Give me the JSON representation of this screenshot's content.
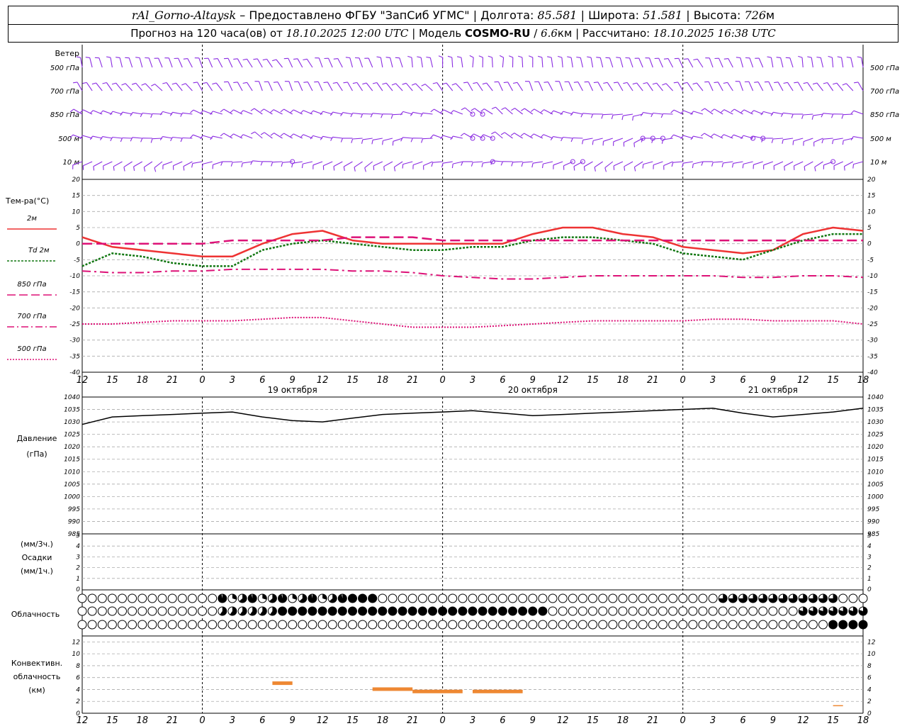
{
  "header": {
    "station": "rAl_Gorno-Altaysk",
    "provider": "Предоставлено ФГБУ \"ЗапСиб УГМС\"",
    "lon_label": "Долгота:",
    "lon": "85.581",
    "lat_label": "Широта:",
    "lat": "51.581",
    "alt_label": "Высота:",
    "alt": "726",
    "alt_unit": "м",
    "forecast_label": "Прогноз на 120 часа(ов)",
    "from_label": "от",
    "issued": "18.10.2025 12:00 UTC",
    "model_label": "Модель",
    "model": "COSMO-RU",
    "resolution_value": "6.6",
    "resolution_unit": "км",
    "computed_label": "Рассчитано:",
    "computed": "18.10.2025 16:38 UTC"
  },
  "wind_panel": {
    "title": "Ветер",
    "levels": [
      "500 гПа",
      "700 гПа",
      "850 гПа",
      "500 м",
      "10  м"
    ]
  },
  "temp_panel": {
    "title": "Тем-ра(°С)",
    "legend": [
      {
        "label": "2м",
        "color": "#ee3333",
        "style": "solid"
      },
      {
        "label": "Td  2м",
        "color": "#117711",
        "style": "dotted"
      },
      {
        "label": "850 гПа",
        "color": "#dd1177",
        "style": "long-dash"
      },
      {
        "label": "700 гПа",
        "color": "#dd1177",
        "style": "dash-dot"
      },
      {
        "label": "500 гПа",
        "color": "#dd1177",
        "style": "dotted"
      }
    ]
  },
  "pressure_panel": {
    "title": "Давление",
    "unit": "(гПа)"
  },
  "precip_panel": {
    "unit1": "(мм/3ч.)",
    "title": "Осадки",
    "unit2": "(мм/1ч.)"
  },
  "cloud_panel": {
    "title": "Облачность"
  },
  "conv_panel": {
    "title1": "Конвективн.",
    "title2": "облачность",
    "unit": "(км)"
  },
  "time_axis": {
    "hour_labels": [
      "12",
      "15",
      "18",
      "21",
      "0",
      "3",
      "6",
      "9",
      "12",
      "15",
      "18",
      "21",
      "0",
      "3",
      "6",
      "9",
      "12",
      "15",
      "18",
      "21",
      "0",
      "3",
      "6",
      "9",
      "12",
      "15",
      "18"
    ],
    "day_labels": [
      {
        "label": "19 октября",
        "hour_index": 7
      },
      {
        "label": "20 октября",
        "hour_index": 15
      },
      {
        "label": "21 октября",
        "hour_index": 23
      }
    ]
  },
  "colors": {
    "wind": "#8a2be2",
    "grid": "#aaaaaa",
    "t2m": "#ee3333",
    "td2m": "#117711",
    "upper": "#dd1177",
    "pressure": "#000000",
    "convective": "#ee8833"
  },
  "chart_data": [
    {
      "type": "line",
      "title": "Тем-ра(°С)",
      "ylim": [
        -40,
        20
      ],
      "yticks": [
        20,
        15,
        10,
        5,
        0,
        -5,
        -10,
        -15,
        -20,
        -25,
        -30,
        -35,
        -40
      ],
      "x_hours": [
        0,
        3,
        6,
        9,
        12,
        15,
        18,
        21,
        24,
        27,
        30,
        33,
        36,
        39,
        42,
        45,
        48,
        51,
        54,
        57,
        60,
        63,
        66,
        69,
        72,
        75,
        78
      ],
      "series": [
        {
          "name": "2м",
          "values": [
            2,
            -1,
            -2,
            -3,
            -4,
            -4,
            0,
            3,
            4,
            1,
            0,
            0,
            0,
            0,
            0,
            3,
            5,
            5,
            3,
            2,
            -1,
            -2,
            -3,
            -2,
            3,
            5,
            4
          ]
        },
        {
          "name": "Td 2м",
          "values": [
            -7,
            -3,
            -4,
            -6,
            -7,
            -7,
            -2,
            0,
            1,
            0,
            -1,
            -2,
            -2,
            -1,
            -1,
            1,
            2,
            2,
            1,
            0,
            -3,
            -4,
            -5,
            -2,
            1,
            3,
            3
          ]
        },
        {
          "name": "850 гПа",
          "values": [
            0,
            0,
            0,
            0,
            0,
            1,
            1,
            1,
            1,
            2,
            2,
            2,
            1,
            1,
            1,
            1,
            1,
            1,
            1,
            1,
            1,
            1,
            1,
            1,
            1,
            1,
            1
          ]
        },
        {
          "name": "700 гПа",
          "values": [
            -8.5,
            -9,
            -9,
            -8.5,
            -8.5,
            -8,
            -8,
            -8,
            -8,
            -8.5,
            -8.5,
            -9,
            -10,
            -10.5,
            -11,
            -11,
            -10.5,
            -10,
            -10,
            -10,
            -10,
            -10,
            -10.5,
            -10.5,
            -10,
            -10,
            -10.5
          ]
        },
        {
          "name": "500 гПа",
          "values": [
            -25,
            -25,
            -24.5,
            -24,
            -24,
            -24,
            -23.5,
            -23,
            -23,
            -24,
            -25,
            -26,
            -26,
            -26,
            -25.5,
            -25,
            -24.5,
            -24,
            -24,
            -24,
            -24,
            -23.5,
            -23.5,
            -24,
            -24,
            -24,
            -25
          ]
        }
      ]
    },
    {
      "type": "line",
      "title": "Давление",
      "ylim": [
        985,
        1040
      ],
      "yticks": [
        1040,
        1035,
        1030,
        1025,
        1020,
        1015,
        1010,
        1005,
        1000,
        995,
        990,
        985
      ],
      "x_hours": [
        0,
        3,
        6,
        9,
        12,
        15,
        18,
        21,
        24,
        27,
        30,
        33,
        36,
        39,
        42,
        45,
        48,
        51,
        54,
        57,
        60,
        63,
        66,
        69,
        72,
        75,
        78
      ],
      "series": [
        {
          "name": "",
          "values": [
            1029,
            1032,
            1032.5,
            1033,
            1033.5,
            1034,
            1032,
            1030.5,
            1030,
            1031.5,
            1033,
            1033.5,
            1034,
            1034.5,
            1033.5,
            1032.5,
            1033,
            1033.5,
            1034,
            1034.5,
            1035,
            1035.5,
            1033.5,
            1032,
            1033,
            1034,
            1035.5
          ]
        }
      ]
    },
    {
      "type": "bar",
      "title": "Осадки",
      "ylim": [
        0,
        5
      ],
      "yticks": [
        5,
        4,
        3,
        2,
        1,
        0
      ],
      "values": []
    },
    {
      "type": "bar",
      "title": "Конвективн. облачность",
      "ylim": [
        0,
        13
      ],
      "yticks": [
        12,
        10,
        8,
        6,
        4,
        2,
        0
      ],
      "ranges": [
        {
          "start_hour": 19,
          "end_hour": 21,
          "height_km": 5
        },
        {
          "start_hour": 29,
          "end_hour": 33,
          "height_km": 4
        },
        {
          "start_hour": 33,
          "end_hour": 38,
          "height_km": 3.6
        },
        {
          "start_hour": 39,
          "end_hour": 44,
          "height_km": 3.6
        },
        {
          "start_hour": 75,
          "end_hour": 76,
          "height_km": 1
        }
      ]
    }
  ]
}
